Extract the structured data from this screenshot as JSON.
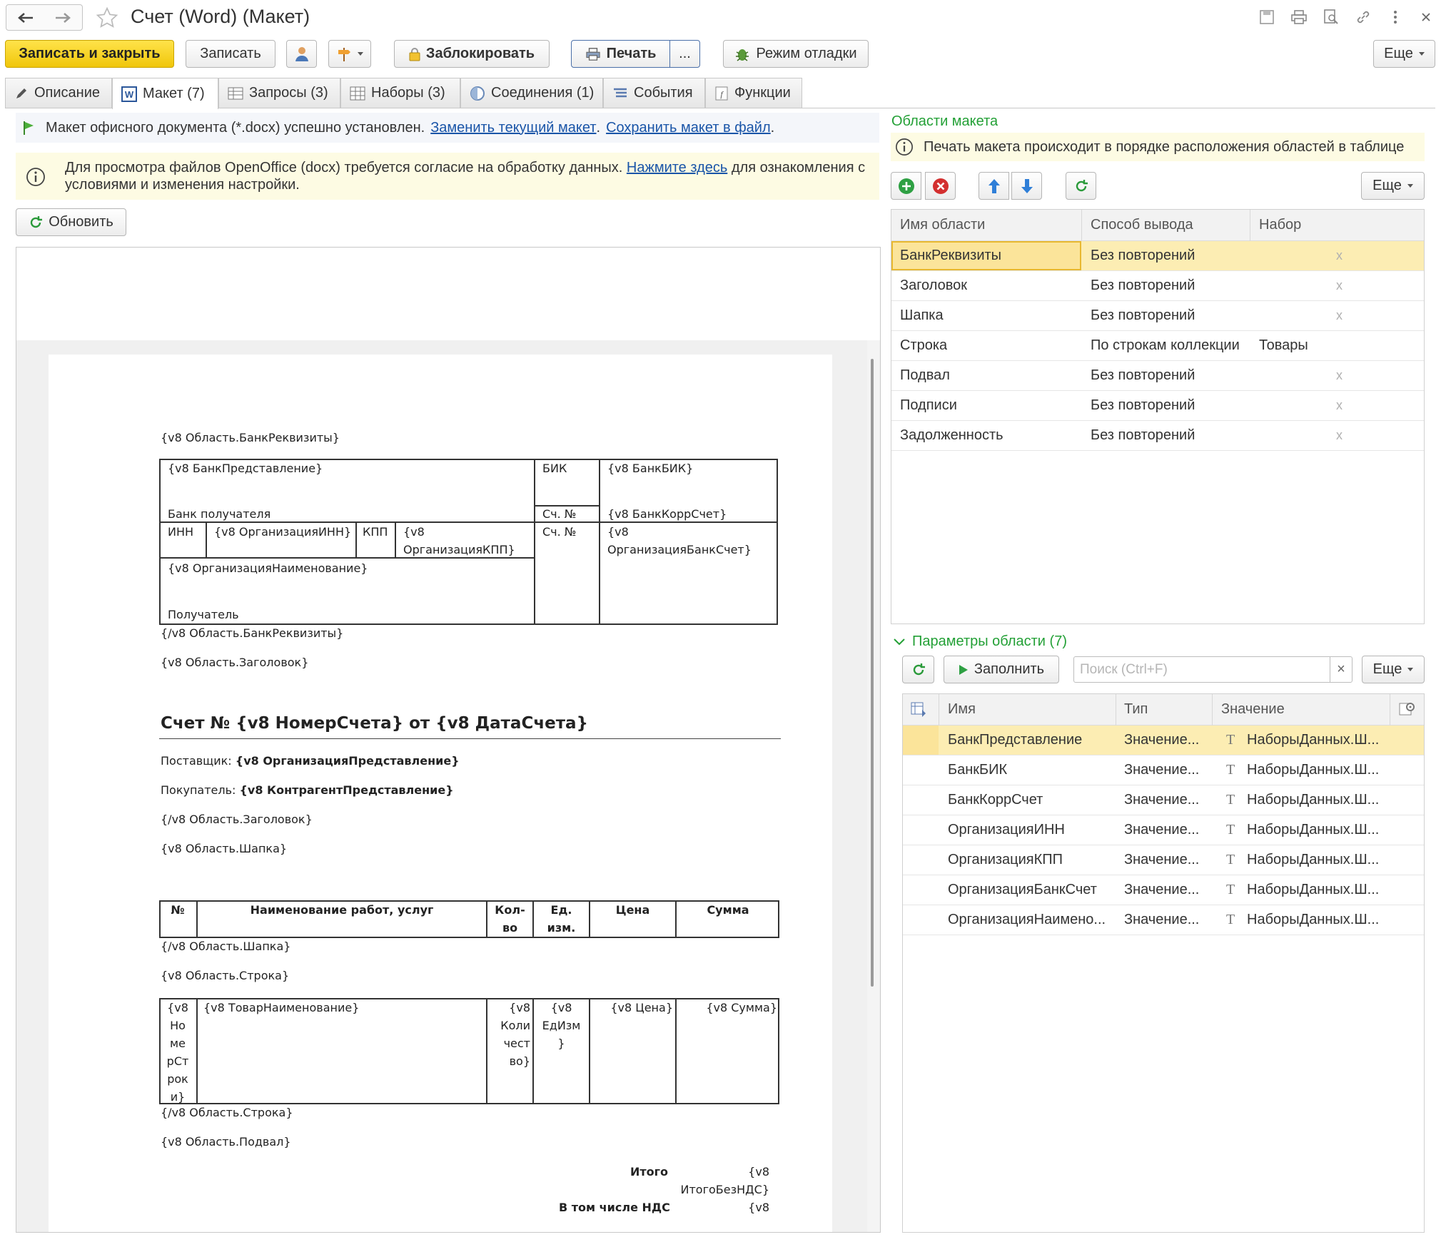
{
  "window": {
    "title": "Счет (Word) (Макет)"
  },
  "toolbar": {
    "save_close": "Записать и закрыть",
    "save": "Записать",
    "lock": "Заблокировать",
    "print": "Печать",
    "print_more": "...",
    "debug": "Режим отладки",
    "more": "Еще"
  },
  "tabs": [
    {
      "label": "Описание"
    },
    {
      "label": "Макет (7)"
    },
    {
      "label": "Запросы (3)"
    },
    {
      "label": "Наборы (3)"
    },
    {
      "label": "Соединения (1)"
    },
    {
      "label": "События"
    },
    {
      "label": "Функции"
    }
  ],
  "notice": {
    "installed_text": "Макет офисного документа (*.docx) успешно установлен.",
    "replace_link": "Заменить текущий макет",
    "save_link": "Сохранить макет в файл",
    "dot": ".",
    "info_text_1": "Для просмотра файлов OpenOffice (docx) требуется согласие на обработку данных.",
    "info_link": "Нажмите здесь",
    "info_text_2": "для ознакомления с",
    "info_text_3": "условиями и изменения настройки."
  },
  "refresh_button": "Обновить",
  "document": {
    "bank_area_open": "{v8 Область.БанкРеквизиты}",
    "bank_repr": "{v8 БанкПредставление}",
    "bik_label": "БИК",
    "bank_bik": "{v8 БанкБИК}",
    "recipient_bank": "Банк получателя",
    "acc_no_label": "Сч. №",
    "bank_corr": "{v8 БанкКоррСчет}",
    "inn_label": "ИНН",
    "org_inn": "{v8 ОрганизацияИНН}",
    "kpp_label": "КПП",
    "org_kpp_1": "{v8",
    "org_kpp_2": "ОрганизацияКПП}",
    "acc_no_label2": "Сч. №",
    "org_acc_1": "{v8",
    "org_acc_2": "ОрганизацияБанкСчет}",
    "org_name": "{v8 ОрганизацияНаименование}",
    "recipient": "Получатель",
    "bank_area_close": "{/v8 Область.БанкРеквизиты}",
    "title_area_open": "{v8 Область.Заголовок}",
    "invoice_title": "Счет № {v8 НомерСчета} от {v8 ДатаСчета}",
    "supplier_label": "Поставщик:",
    "supplier_value": "{v8 ОрганизацияПредставление}",
    "buyer_label": "Покупатель:",
    "buyer_value": "{v8 КонтрагентПредставление}",
    "title_area_close": "{/v8 Область.Заголовок}",
    "head_area_open": "{v8 Область.Шапка}",
    "col_no": "№",
    "col_name": "Наименование работ, услуг",
    "col_qty_1": "Кол-",
    "col_qty_2": "во",
    "col_unit_1": "Ед.",
    "col_unit_2": "изм.",
    "col_price": "Цена",
    "col_sum": "Сумма",
    "head_area_close": "{/v8 Область.Шапка}",
    "row_area_open": "{v8 Область.Строка}",
    "row_no": [
      "{v8",
      "Но",
      "ме",
      "рСт",
      "рок",
      "и}"
    ],
    "row_name": "{v8 ТоварНаименование}",
    "row_qty": [
      "{v8",
      "Коли",
      "чест",
      "во}"
    ],
    "row_unit": [
      "{v8",
      "ЕдИзм",
      "}"
    ],
    "row_price": "{v8 Цена}",
    "row_sum": "{v8 Сумма}",
    "row_area_close": "{/v8 Область.Строка}",
    "footer_area_open": "{v8 Область.Подвал}",
    "total_label": "Итого",
    "total_value_1": "{v8",
    "total_value_2": "ИтогоБезНДС}",
    "vat_label": "В том числе НДС",
    "vat_value": "{v8"
  },
  "areas_panel": {
    "title": "Области макета",
    "info": "Печать макета происходит в порядке расположения областей в таблице",
    "more": "Еще",
    "columns": [
      "Имя области",
      "Способ вывода",
      "Набор"
    ],
    "rows": [
      {
        "name": "БанкРеквизиты",
        "mode": "Без повторений",
        "set": "",
        "clear": "x"
      },
      {
        "name": "Заголовок",
        "mode": "Без повторений",
        "set": "",
        "clear": "x"
      },
      {
        "name": "Шапка",
        "mode": "Без повторений",
        "set": "",
        "clear": "x"
      },
      {
        "name": "Строка",
        "mode": "По строкам коллекции",
        "set": "Товары",
        "clear": ""
      },
      {
        "name": "Подвал",
        "mode": "Без повторений",
        "set": "",
        "clear": "x"
      },
      {
        "name": "Подписи",
        "mode": "Без повторений",
        "set": "",
        "clear": "x"
      },
      {
        "name": "Задолженность",
        "mode": "Без повторений",
        "set": "",
        "clear": "x"
      }
    ]
  },
  "params_panel": {
    "title": "Параметры области (7)",
    "fill": "Заполнить",
    "search_placeholder": "Поиск (Ctrl+F)",
    "clear": "×",
    "more": "Еще",
    "columns": [
      "Имя",
      "Тип",
      "Значение"
    ],
    "rows": [
      {
        "name": "БанкПредставление",
        "type": "Значение...",
        "value": "НаборыДанных.Ш..."
      },
      {
        "name": "БанкБИК",
        "type": "Значение...",
        "value": "НаборыДанных.Ш..."
      },
      {
        "name": "БанкКоррСчет",
        "type": "Значение...",
        "value": "НаборыДанных.Ш..."
      },
      {
        "name": "ОрганизацияИНН",
        "type": "Значение...",
        "value": "НаборыДанных.Ш..."
      },
      {
        "name": "ОрганизацияКПП",
        "type": "Значение...",
        "value": "НаборыДанных.Ш..."
      },
      {
        "name": "ОрганизацияБанкСчет",
        "type": "Значение...",
        "value": "НаборыДанных.Ш..."
      },
      {
        "name": "ОрганизацияНаимено...",
        "type": "Значение...",
        "value": "НаборыДанных.Ш..."
      }
    ]
  },
  "colors": {
    "accent_yellow": "#f5d320",
    "link": "#1a55a8",
    "green": "#23a036",
    "selection": "#fcedb3"
  }
}
